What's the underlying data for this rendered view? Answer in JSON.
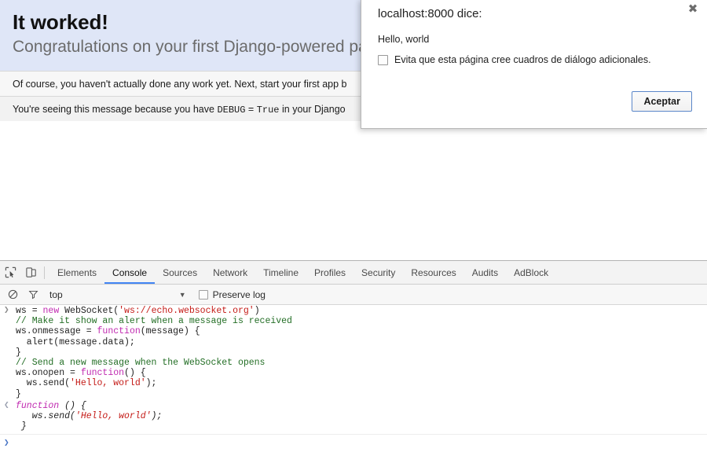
{
  "page": {
    "hero_title": "It worked!",
    "hero_subtitle": "Congratulations on your first Django-powered page.",
    "note_one_before": "Of course, you haven't actually done any work yet. Next, start your first app b",
    "note_two_a": "You're seeing this message because you have ",
    "note_two_code1": "DEBUG",
    "note_two_eq": " = ",
    "note_two_code2": "True",
    "note_two_b": " in your Django"
  },
  "dialog": {
    "title": "localhost:8000 dice:",
    "message": "Hello, world",
    "suppress_label": "Evita que esta página cree cuadros de diálogo adicionales.",
    "accept_label": "Aceptar",
    "close_glyph": "✖",
    "accent_border": "#5b87c9"
  },
  "devtools": {
    "tabs": [
      {
        "label": "Elements",
        "active": false
      },
      {
        "label": "Console",
        "active": true
      },
      {
        "label": "Sources",
        "active": false
      },
      {
        "label": "Network",
        "active": false
      },
      {
        "label": "Timeline",
        "active": false
      },
      {
        "label": "Profiles",
        "active": false
      },
      {
        "label": "Security",
        "active": false
      },
      {
        "label": "Resources",
        "active": false
      },
      {
        "label": "Audits",
        "active": false
      },
      {
        "label": "AdBlock",
        "active": false
      }
    ],
    "active_tab_color": "#4285f4",
    "filterbar": {
      "context": "top",
      "caret": "▼",
      "preserve_log": "Preserve log",
      "preserve_checked": false
    },
    "console": {
      "input_marker": "❯",
      "output_marker": "❮",
      "prompt_marker": "❯",
      "input_lines": [
        [
          {
            "t": "ws = ",
            "c": "plain"
          },
          {
            "t": "new",
            "c": "kw"
          },
          {
            "t": " WebSocket(",
            "c": "plain"
          },
          {
            "t": "'ws://echo.websocket.org'",
            "c": "str"
          },
          {
            "t": ")",
            "c": "plain"
          }
        ],
        [
          {
            "t": "// Make it show an alert when a message is received",
            "c": "com"
          }
        ],
        [
          {
            "t": "ws.onmessage = ",
            "c": "plain"
          },
          {
            "t": "function",
            "c": "kw"
          },
          {
            "t": "(message) {",
            "c": "plain"
          }
        ],
        [
          {
            "t": "  alert(message.data);",
            "c": "plain"
          }
        ],
        [
          {
            "t": "}",
            "c": "plain"
          }
        ],
        [
          {
            "t": "// Send a new message when the WebSocket opens",
            "c": "com"
          }
        ],
        [
          {
            "t": "ws.onopen = ",
            "c": "plain"
          },
          {
            "t": "function",
            "c": "kw"
          },
          {
            "t": "() {",
            "c": "plain"
          }
        ],
        [
          {
            "t": "  ws.send(",
            "c": "plain"
          },
          {
            "t": "'Hello, world'",
            "c": "str"
          },
          {
            "t": ");",
            "c": "plain"
          }
        ],
        [
          {
            "t": "}",
            "c": "plain"
          }
        ]
      ],
      "output_lines": [
        [
          {
            "t": "function",
            "c": "kw"
          },
          {
            "t": " () {",
            "c": "plain"
          }
        ],
        [
          {
            "t": "   ws.send(",
            "c": "plain"
          },
          {
            "t": "'Hello, world'",
            "c": "str"
          },
          {
            "t": ");",
            "c": "plain"
          }
        ],
        [
          {
            "t": " }",
            "c": "plain"
          }
        ]
      ]
    }
  }
}
